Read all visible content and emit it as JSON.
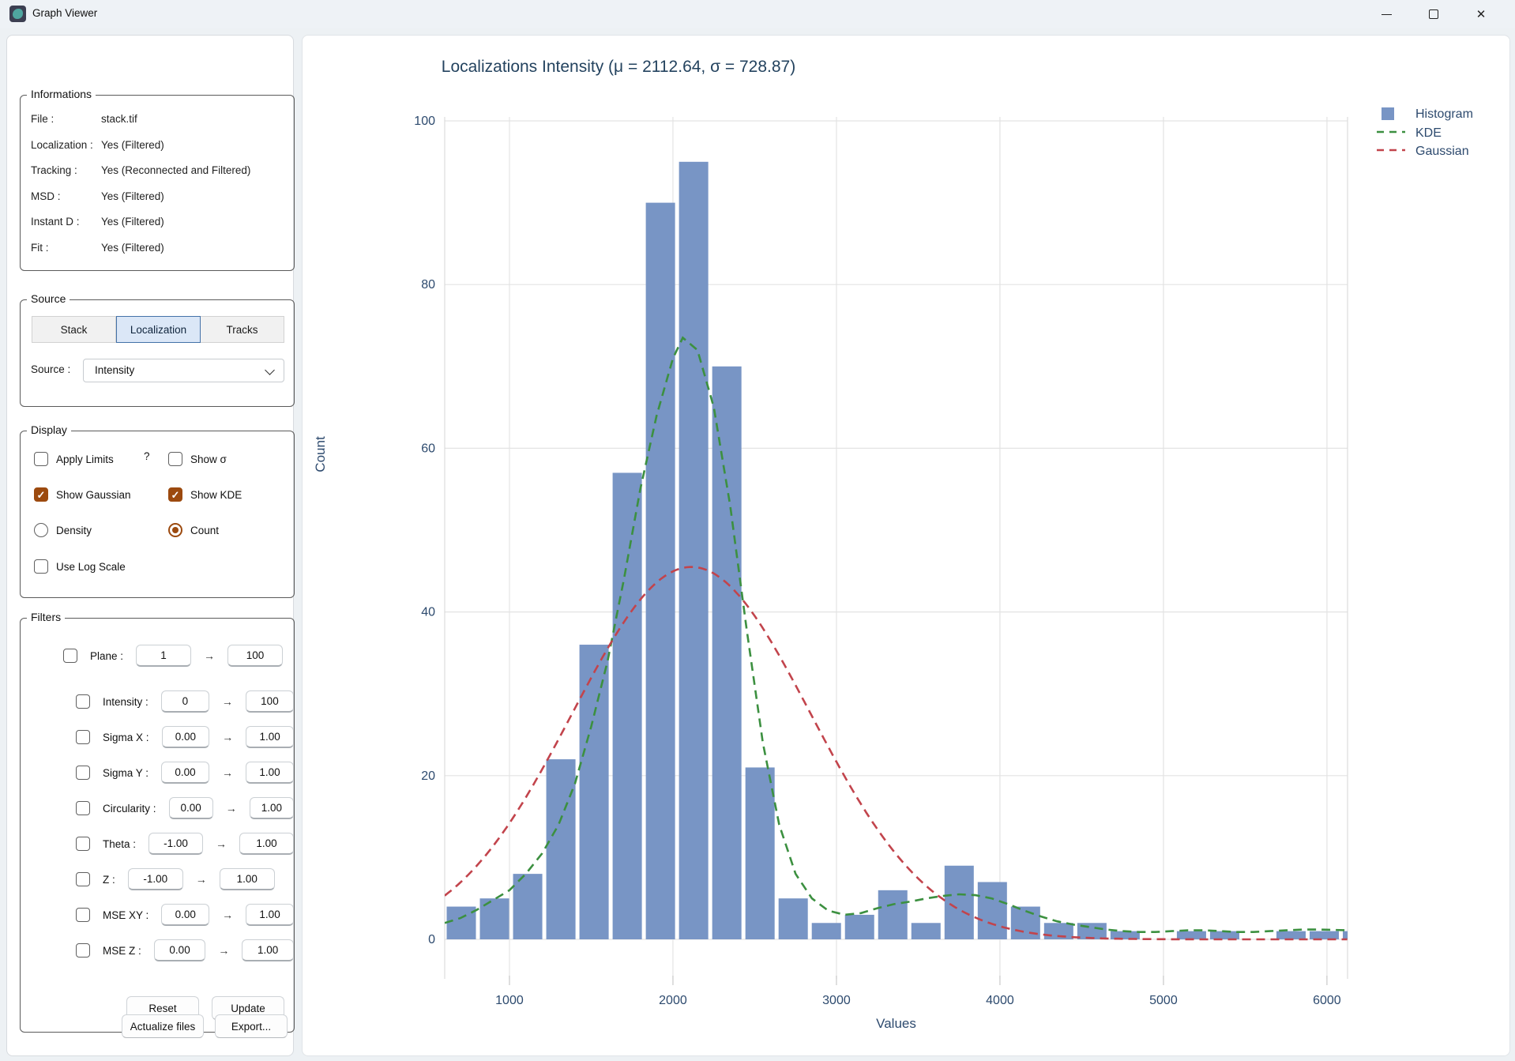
{
  "window": {
    "title": "Graph Viewer"
  },
  "panel": {
    "informations": {
      "label": "Informations",
      "rows": [
        {
          "label": "File :",
          "value": "stack.tif"
        },
        {
          "label": "Localization :",
          "value": "Yes (Filtered)"
        },
        {
          "label": "Tracking :",
          "value": "Yes (Reconnected and Filtered)"
        },
        {
          "label": "MSD :",
          "value": "Yes (Filtered)"
        },
        {
          "label": "Instant D :",
          "value": "Yes (Filtered)"
        },
        {
          "label": "Fit :",
          "value": "Yes (Filtered)"
        }
      ]
    },
    "source": {
      "label": "Source",
      "tabs": [
        {
          "label": "Stack",
          "selected": false
        },
        {
          "label": "Localization",
          "selected": true
        },
        {
          "label": "Tracks",
          "selected": false
        }
      ],
      "source_label": "Source :",
      "selected_source": "Intensity"
    },
    "display": {
      "label": "Display",
      "help": "?",
      "items": {
        "apply_limits": {
          "label": "Apply Limits",
          "checked": false
        },
        "show_sigma": {
          "label": "Show σ",
          "checked": false
        },
        "show_gaussian": {
          "label": "Show Gaussian",
          "checked": true
        },
        "show_kde": {
          "label": "Show KDE",
          "checked": true
        },
        "density": {
          "label": "Density",
          "selected": false
        },
        "count": {
          "label": "Count",
          "selected": true
        },
        "use_log_scale": {
          "label": "Use Log Scale",
          "checked": false
        }
      }
    },
    "filters": {
      "label": "Filters",
      "arrow": "→",
      "rows": [
        {
          "label": "Plane :",
          "from": "1",
          "to": "100"
        },
        {
          "label": "Intensity :",
          "from": "0",
          "to": "100"
        },
        {
          "label": "Sigma X :",
          "from": "0.00",
          "to": "1.00"
        },
        {
          "label": "Sigma Y :",
          "from": "0.00",
          "to": "1.00"
        },
        {
          "label": "Circularity :",
          "from": "0.00",
          "to": "1.00"
        },
        {
          "label": "Theta :",
          "from": "-1.00",
          "to": "1.00"
        },
        {
          "label": "Z :",
          "from": "-1.00",
          "to": "1.00"
        },
        {
          "label": "MSE XY :",
          "from": "0.00",
          "to": "1.00"
        },
        {
          "label": "MSE Z :",
          "from": "0.00",
          "to": "1.00"
        }
      ],
      "reset": "Reset",
      "update": "Update"
    },
    "actions": {
      "actualize": "Actualize files",
      "export": "Export..."
    }
  },
  "chart_data": {
    "type": "bar",
    "title": "Localizations Intensity (μ = 2112.64, σ = 728.87)",
    "xlabel": "Values",
    "ylabel": "Count",
    "xlim": [
      604,
      6126
    ],
    "ylim": [
      0,
      100
    ],
    "x_ticks": [
      1000,
      2000,
      3000,
      4000,
      5000,
      6000
    ],
    "y_ticks": [
      0,
      20,
      40,
      60,
      80,
      100
    ],
    "grid": true,
    "legend_position": "outside-right",
    "legend": [
      "Histogram",
      "KDE",
      "Gaussian"
    ],
    "histogram": {
      "label": "Histogram",
      "color": "#7895c5",
      "bin_start": 604,
      "bin_width": 203,
      "counts": [
        4,
        5,
        8,
        22,
        36,
        57,
        90,
        95,
        70,
        21,
        5,
        2,
        3,
        6,
        2,
        9,
        7,
        4,
        2,
        2,
        1,
        0,
        1,
        1,
        0,
        1,
        1,
        1
      ]
    },
    "kde": {
      "label": "KDE",
      "color": "#3c9040",
      "points": [
        [
          604,
          2.0
        ],
        [
          700,
          2.6
        ],
        [
          800,
          3.6
        ],
        [
          900,
          4.8
        ],
        [
          1000,
          6.0
        ],
        [
          1100,
          8.0
        ],
        [
          1200,
          10.5
        ],
        [
          1300,
          14.0
        ],
        [
          1400,
          19.0
        ],
        [
          1500,
          26.0
        ],
        [
          1600,
          34.0
        ],
        [
          1700,
          44.0
        ],
        [
          1800,
          55.0
        ],
        [
          1900,
          64.0
        ],
        [
          2000,
          71.0
        ],
        [
          2060,
          73.5
        ],
        [
          2150,
          72.0
        ],
        [
          2250,
          65.0
        ],
        [
          2350,
          53.0
        ],
        [
          2450,
          38.0
        ],
        [
          2550,
          24.0
        ],
        [
          2650,
          14.0
        ],
        [
          2750,
          8.0
        ],
        [
          2850,
          5.0
        ],
        [
          2950,
          3.5
        ],
        [
          3050,
          3.0
        ],
        [
          3150,
          3.2
        ],
        [
          3250,
          3.8
        ],
        [
          3350,
          4.3
        ],
        [
          3450,
          4.6
        ],
        [
          3550,
          5.0
        ],
        [
          3650,
          5.3
        ],
        [
          3750,
          5.5
        ],
        [
          3850,
          5.4
        ],
        [
          3950,
          5.0
        ],
        [
          4050,
          4.3
        ],
        [
          4150,
          3.5
        ],
        [
          4250,
          2.8
        ],
        [
          4350,
          2.2
        ],
        [
          4450,
          1.8
        ],
        [
          4550,
          1.5
        ],
        [
          4650,
          1.2
        ],
        [
          4750,
          1.0
        ],
        [
          4850,
          0.9
        ],
        [
          4950,
          0.9
        ],
        [
          5050,
          1.0
        ],
        [
          5150,
          1.1
        ],
        [
          5250,
          1.1
        ],
        [
          5350,
          1.0
        ],
        [
          5450,
          0.9
        ],
        [
          5550,
          0.9
        ],
        [
          5650,
          1.0
        ],
        [
          5750,
          1.1
        ],
        [
          5850,
          1.2
        ],
        [
          5950,
          1.2
        ],
        [
          6050,
          1.15
        ],
        [
          6126,
          1.1
        ]
      ]
    },
    "gaussian": {
      "label": "Gaussian",
      "color": "#c2444c",
      "amplitude": 45.5,
      "mu": 2112.64,
      "sigma": 728.87
    },
    "stats": {
      "mu": "2112.64",
      "sigma": "728.87"
    },
    "text_color": "#2d4a6e",
    "grid_color": "#e3e3e3"
  }
}
